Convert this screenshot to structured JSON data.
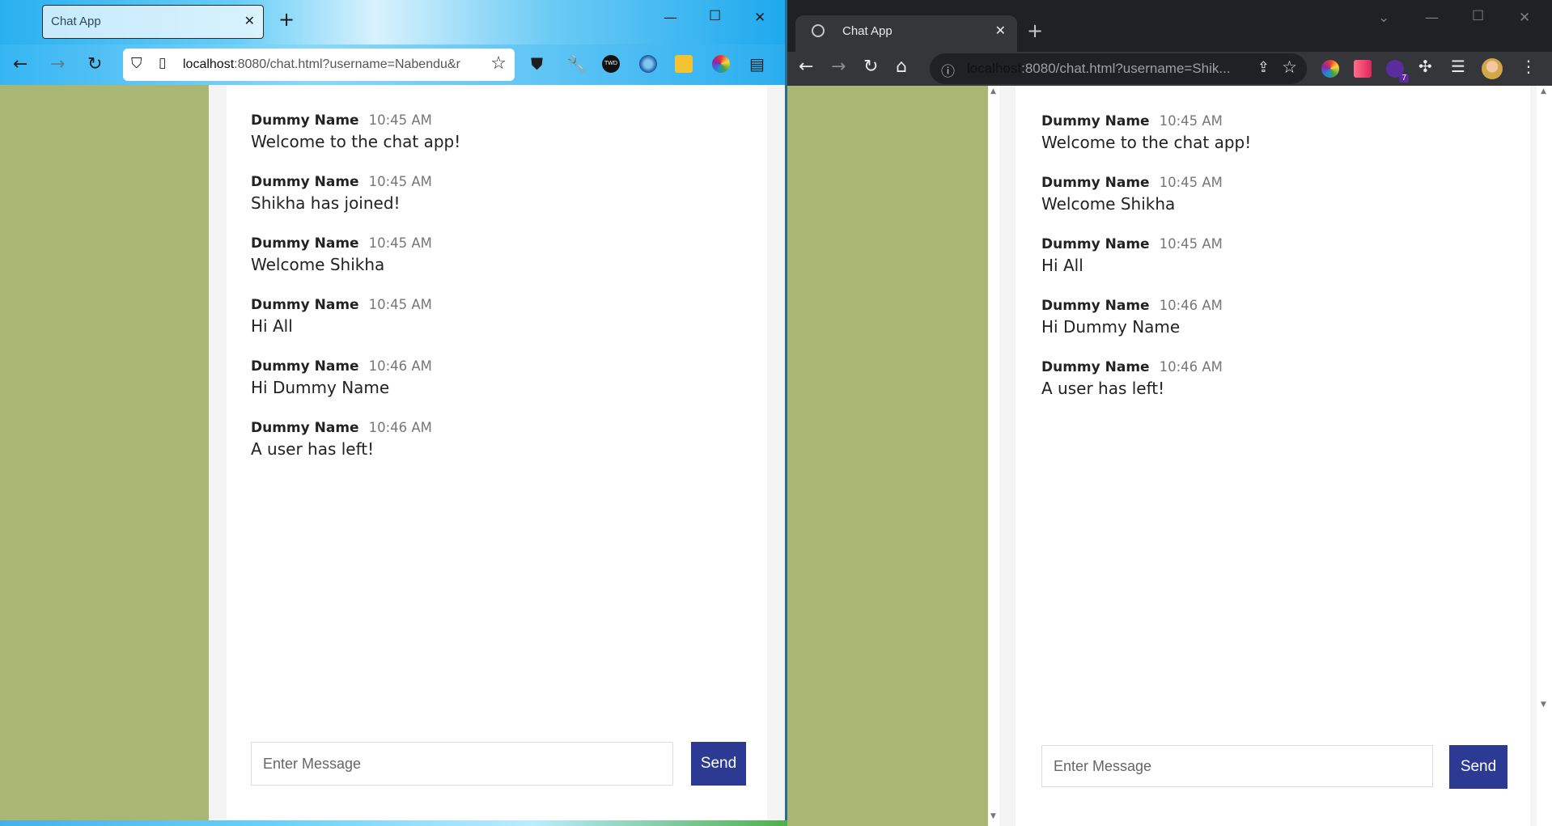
{
  "firefox": {
    "tab_title": "Chat App",
    "url_host": "localhost",
    "url_rest": ":8080/chat.html?username=Nabendu&r",
    "messages": [
      {
        "name": "Dummy Name",
        "time": "10:45 AM",
        "text": "Welcome to the chat app!"
      },
      {
        "name": "Dummy Name",
        "time": "10:45 AM",
        "text": "Shikha has joined!"
      },
      {
        "name": "Dummy Name",
        "time": "10:45 AM",
        "text": "Welcome Shikha"
      },
      {
        "name": "Dummy Name",
        "time": "10:45 AM",
        "text": "Hi All"
      },
      {
        "name": "Dummy Name",
        "time": "10:46 AM",
        "text": "Hi Dummy Name"
      },
      {
        "name": "Dummy Name",
        "time": "10:46 AM",
        "text": "A user has left!"
      }
    ],
    "input_placeholder": "Enter Message",
    "send_label": "Send",
    "ext_badge": "TWD"
  },
  "chrome": {
    "tab_title": "Chat App",
    "url_host": "localhost",
    "url_rest": ":8080/chat.html?username=Shik...",
    "messages": [
      {
        "name": "Dummy Name",
        "time": "10:45 AM",
        "text": "Welcome to the chat app!"
      },
      {
        "name": "Dummy Name",
        "time": "10:45 AM",
        "text": "Welcome Shikha"
      },
      {
        "name": "Dummy Name",
        "time": "10:45 AM",
        "text": "Hi All"
      },
      {
        "name": "Dummy Name",
        "time": "10:46 AM",
        "text": "Hi Dummy Name"
      },
      {
        "name": "Dummy Name",
        "time": "10:46 AM",
        "text": "A user has left!"
      }
    ],
    "input_placeholder": "Enter Message",
    "send_label": "Send",
    "ext_badge_count": "7"
  }
}
